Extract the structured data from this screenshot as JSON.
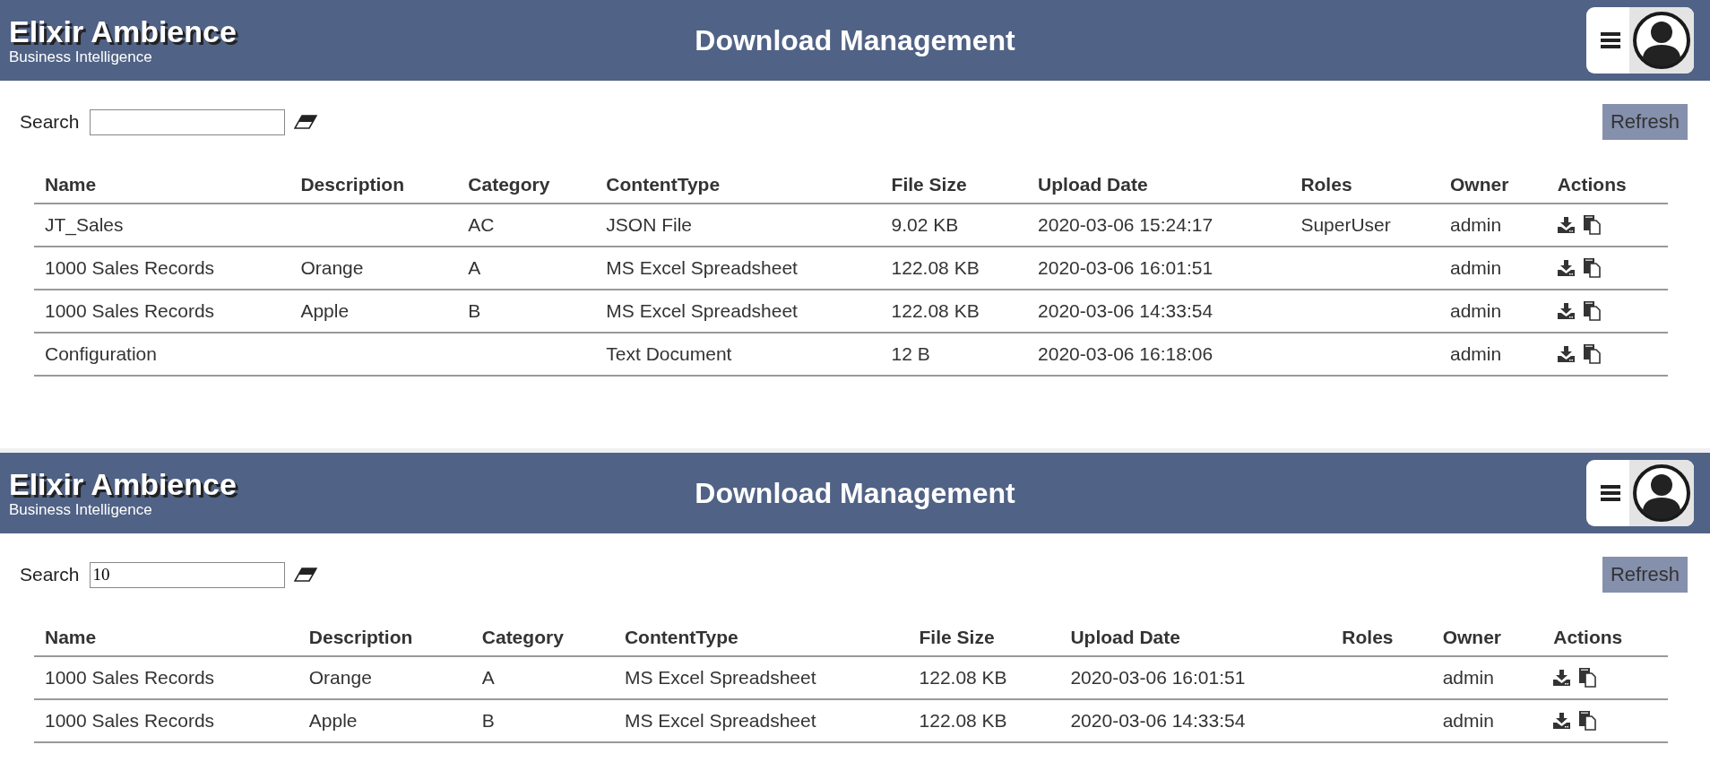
{
  "panels": [
    {
      "header": {
        "title": "Elixir Ambience",
        "subtitle": "Business Intelligence",
        "page_title": "Download Management"
      },
      "search": {
        "label": "Search"
      },
      "refresh_button": "Refresh",
      "table": {
        "columns": [
          "Name",
          "Description",
          "Category",
          "ContentType",
          "File Size",
          "Upload Date",
          "Roles",
          "Owner",
          "Actions"
        ],
        "rows": [
          [
            "JT_Sales",
            "",
            "AC",
            "JSON File",
            "9.02 KB",
            "2020-03-06 15:24:17",
            "SuperUser",
            "admin"
          ],
          [
            "1000 Sales Records",
            "Orange",
            "A",
            "MS Excel Spreadsheet",
            "122.08 KB",
            "2020-03-06 16:01:51",
            "",
            "admin"
          ],
          [
            "1000 Sales Records",
            "Apple",
            "B",
            "MS Excel Spreadsheet",
            "122.08 KB",
            "2020-03-06 14:33:54",
            "",
            "admin"
          ],
          [
            "Configuration",
            "",
            "",
            "Text Document",
            "12 B",
            "2020-03-06 16:18:06",
            "",
            "admin"
          ]
        ]
      }
    },
    {
      "header": {
        "title": "Elixir Ambience",
        "subtitle": "Business Intelligence",
        "page_title": "Download Management"
      },
      "search": {
        "label": "Search",
        "value": "10"
      },
      "refresh_button": "Refresh",
      "table": {
        "columns": [
          "Name",
          "Description",
          "Category",
          "ContentType",
          "File Size",
          "Upload Date",
          "Roles",
          "Owner",
          "Actions"
        ],
        "rows": [
          [
            "1000 Sales Records",
            "Orange",
            "A",
            "MS Excel Spreadsheet",
            "122.08 KB",
            "2020-03-06 16:01:51",
            "",
            "admin"
          ],
          [
            "1000 Sales Records",
            "Apple",
            "B",
            "MS Excel Spreadsheet",
            "122.08 KB",
            "2020-03-06 14:33:54",
            "",
            "admin"
          ]
        ]
      }
    }
  ]
}
